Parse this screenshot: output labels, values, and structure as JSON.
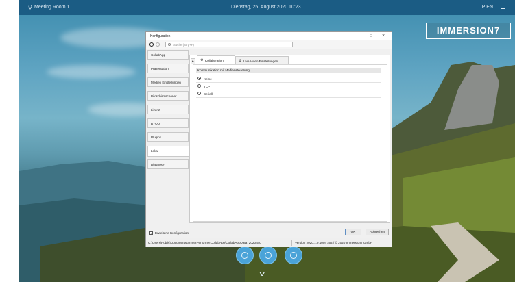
{
  "topbar": {
    "room": "Meeting Room 1",
    "datetime": "Dienstag, 25. August 2020   10:23",
    "lang": "P EN"
  },
  "brand": {
    "logo_text": "IMMERSION7"
  },
  "dialog": {
    "title": "Konfiguration",
    "search_placeholder": "Suche (Strg+F)",
    "sidebar_items": [
      {
        "label": "CollabApp"
      },
      {
        "label": "Präsentation"
      },
      {
        "label": "Medien Einstellungen"
      },
      {
        "label": "Bildschirmschoner"
      },
      {
        "label": "Lizenz"
      },
      {
        "label": "BYOD"
      },
      {
        "label": "Plugins"
      },
      {
        "label": "Lokal"
      },
      {
        "label": "Diagnose"
      }
    ],
    "active_sidebar": "Lokal",
    "tabs": [
      {
        "label": "Kollaboration"
      },
      {
        "label": "Live Video Einstellungen"
      }
    ],
    "group_title": "Kommunikation mit Mediensteuerung",
    "radio_options": [
      {
        "label": "Keine",
        "selected": true
      },
      {
        "label": "TCP",
        "selected": false
      },
      {
        "label": "Seriell",
        "selected": false
      }
    ],
    "advanced_label": "Erweiterte Konfiguration",
    "advanced_checked": true,
    "ok_label": "OK",
    "cancel_label": "Abbrechen",
    "status_path": "C:\\Users\\Public\\Documents\\ImmerPerformerCollabApp\\CollabAppData_2020.5.0",
    "status_version": "Version 2020.1.0.1004 x64  /  ©  2020 Immersion7 GmbH"
  },
  "colors": {
    "topbar": "#1b5c84",
    "dock_button": "#4aa3d8"
  },
  "icons": [
    "location-icon",
    "window-icon",
    "settings-gear-icon",
    "key-icon",
    "power-icon",
    "info-icon",
    "chevron-down-icon"
  ]
}
